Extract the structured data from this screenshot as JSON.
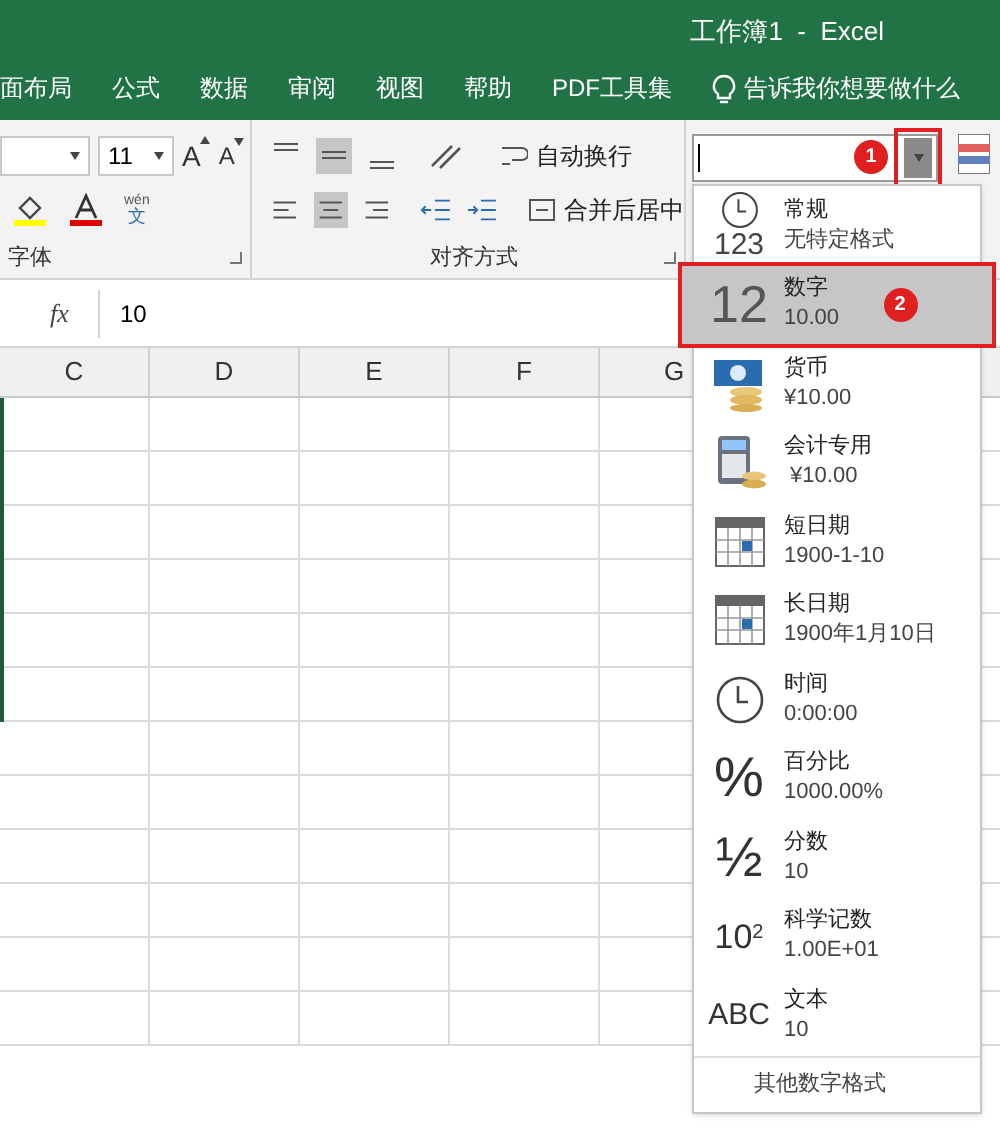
{
  "window": {
    "title": "工作簿1  -  Excel"
  },
  "tabs": [
    {
      "label": "面布局"
    },
    {
      "label": "公式"
    },
    {
      "label": "数据"
    },
    {
      "label": "审阅"
    },
    {
      "label": "视图"
    },
    {
      "label": "帮助"
    },
    {
      "label": "PDF工具集"
    }
  ],
  "tell_me": "告诉我你想要做什么",
  "ribbon": {
    "font_size": "11",
    "grow_font": "A",
    "shrink_font": "A",
    "phonetic_top": "wén",
    "phonetic_bottom": "文",
    "wrap_text": "自动换行",
    "merge_center": "合并后居中",
    "font_group": "字体",
    "align_group": "对齐方式"
  },
  "formula_bar": {
    "fx": "fx",
    "value": "10"
  },
  "columns": [
    "C",
    "D",
    "E",
    "F",
    "G"
  ],
  "number_format": {
    "badge_dropdown": "1",
    "badge_item": "2",
    "items": [
      {
        "kind": "general",
        "name": "常规",
        "sample": "无特定格式",
        "icon_text": "123",
        "selected": false
      },
      {
        "kind": "number",
        "name": "数字",
        "sample": "10.00",
        "icon_text": "12",
        "selected": true
      },
      {
        "kind": "currency",
        "name": "货币",
        "sample": "¥10.00",
        "selected": false
      },
      {
        "kind": "accounting",
        "name": "会计专用",
        "sample": " ¥10.00",
        "selected": false
      },
      {
        "kind": "calendar",
        "name": "短日期",
        "sample": "1900-1-10",
        "selected": false
      },
      {
        "kind": "calendar",
        "name": "长日期",
        "sample": "1900年1月10日",
        "selected": false
      },
      {
        "kind": "time",
        "name": "时间",
        "sample": "0:00:00",
        "selected": false
      },
      {
        "kind": "glyph",
        "name": "百分比",
        "sample": "1000.00%",
        "icon_text": "%",
        "selected": false
      },
      {
        "kind": "glyph",
        "name": "分数",
        "sample": "10",
        "icon_text": "½",
        "selected": false
      },
      {
        "kind": "power",
        "name": "科学记数",
        "sample": "1.00E+01",
        "icon_text": "10",
        "icon_sup": "2",
        "selected": false
      },
      {
        "kind": "abc",
        "name": "文本",
        "sample": "10",
        "icon_text": "ABC",
        "selected": false
      }
    ],
    "more": "其他数字格式"
  }
}
